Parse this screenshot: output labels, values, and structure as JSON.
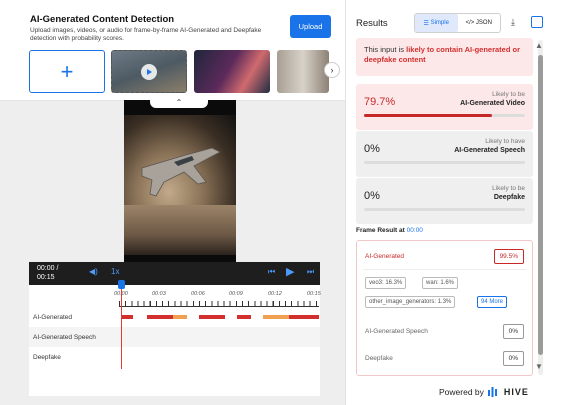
{
  "upload": {
    "title": "AI-Generated Content Detection",
    "subtitle": "Upload images, videos, or audio for frame-by-frame AI-Generated and Deepfake detection with probability scores.",
    "button_label": "Upload",
    "add_label": "+"
  },
  "timeline": {
    "current_time": "00:00 /",
    "duration": "00:15",
    "speed": "1x",
    "ticks": [
      "00:00",
      "00:03",
      "00:06",
      "00:09",
      "00:12",
      "00:15"
    ],
    "rows": [
      "AI-Generated",
      "AI-Generated Speech",
      "Deepfake"
    ]
  },
  "results": {
    "title": "Results",
    "tab_simple": "Simple",
    "tab_json": "</> JSON",
    "alert_prefix": "This input is ",
    "alert_emphasis": "likely to contain AI-generated or deepfake content",
    "cards": [
      {
        "pct": "79.7%",
        "small": "Likely to be",
        "big": "AI-Generated Video",
        "level": 0.797
      },
      {
        "pct": "0%",
        "small": "Likely to have",
        "big": "AI-Generated Speech",
        "level": 0
      },
      {
        "pct": "0%",
        "small": "Likely to be",
        "big": "Deepfake",
        "level": 0
      }
    ],
    "frame_label": "Frame Result at ",
    "frame_time": "00:00",
    "frame_rows": [
      {
        "name": "AI-Generated",
        "value": "99.5%"
      },
      {
        "name": "AI-Generated Speech",
        "value": "0%"
      },
      {
        "name": "Deepfake",
        "value": "0%"
      }
    ],
    "chips": [
      "veo3: 16.3%",
      "wan: 1.6%",
      "other_image_generators: 1.3%",
      "94 More"
    ]
  },
  "footer": {
    "powered_by": "Powered by",
    "brand": "HIVE"
  },
  "colors": {
    "accent": "#1a73e8",
    "danger": "#c62828",
    "timeline_red": "#d32f2f",
    "timeline_orange": "#f0a050"
  }
}
